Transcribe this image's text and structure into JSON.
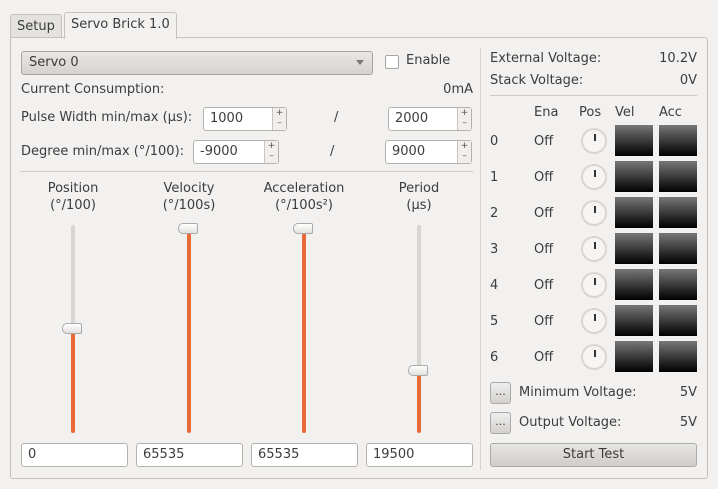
{
  "tabs": [
    {
      "label": "Setup"
    },
    {
      "label": "Servo Brick 1.0"
    }
  ],
  "servo_select": "Servo 0",
  "enable_label": "Enable",
  "current": {
    "label": "Current Consumption:",
    "value": "0mA"
  },
  "pulse": {
    "label": "Pulse Width min/max (µs):",
    "min": "1000",
    "max": "2000",
    "sep": "/"
  },
  "degree": {
    "label": "Degree min/max (°/100):",
    "min": "-9000",
    "max": "9000",
    "sep": "/"
  },
  "sliders": [
    {
      "title": "Position",
      "unit": "(°/100)",
      "value": "0",
      "fraction": 0.5
    },
    {
      "title": "Velocity",
      "unit": "(°/100s)",
      "value": "65535",
      "fraction": 1.0
    },
    {
      "title": "Acceleration",
      "unit": "(°/100s²)",
      "value": "65535",
      "fraction": 1.0
    },
    {
      "title": "Period",
      "unit": "(µs)",
      "value": "19500",
      "fraction": 0.29
    }
  ],
  "spin_plus": "+",
  "spin_minus": "–",
  "external_voltage": {
    "label": "External Voltage:",
    "value": "10.2V"
  },
  "stack_voltage": {
    "label": "Stack Voltage:",
    "value": "0V"
  },
  "table": {
    "headers": [
      "Ena",
      "Pos",
      "Vel",
      "Acc"
    ],
    "rows": [
      {
        "id": "0",
        "ena": "Off"
      },
      {
        "id": "1",
        "ena": "Off"
      },
      {
        "id": "2",
        "ena": "Off"
      },
      {
        "id": "3",
        "ena": "Off"
      },
      {
        "id": "4",
        "ena": "Off"
      },
      {
        "id": "5",
        "ena": "Off"
      },
      {
        "id": "6",
        "ena": "Off"
      }
    ]
  },
  "min_voltage": {
    "button": "...",
    "label": "Minimum Voltage:",
    "value": "5V"
  },
  "output_voltage": {
    "button": "...",
    "label": "Output Voltage:",
    "value": "5V"
  },
  "start_test": "Start Test",
  "colors": {
    "accent": "#e86a38"
  }
}
